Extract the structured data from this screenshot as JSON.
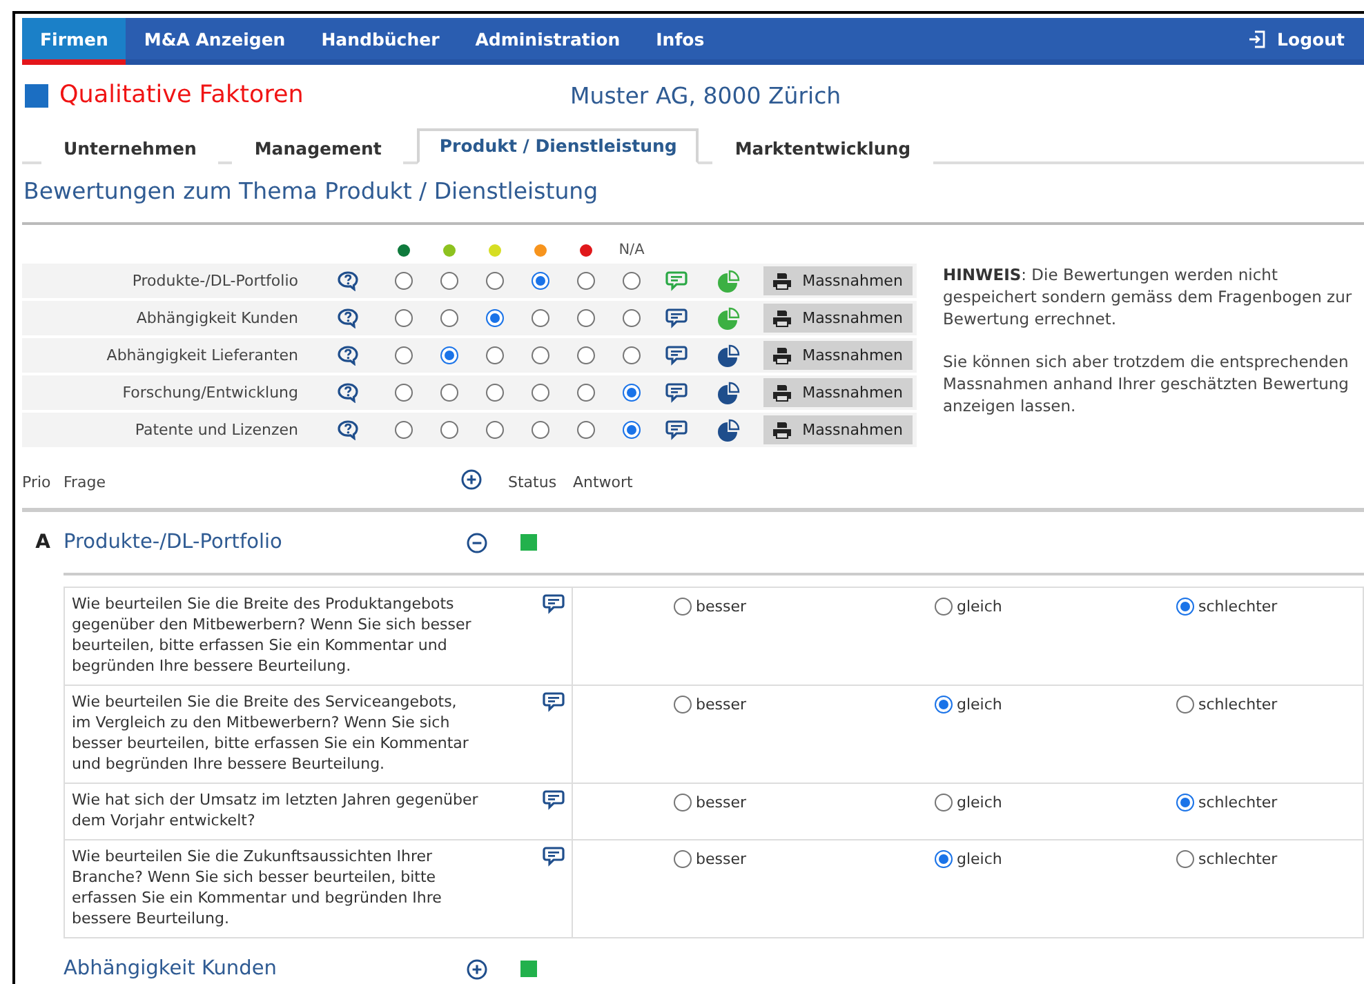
{
  "nav": {
    "items": [
      {
        "label": "Firmen",
        "selected": true
      },
      {
        "label": "M&A Anzeigen",
        "selected": false
      },
      {
        "label": "Handbücher",
        "selected": false
      },
      {
        "label": "Administration",
        "selected": false
      },
      {
        "label": "Infos",
        "selected": false
      }
    ],
    "logout": "Logout"
  },
  "header": {
    "title": "Qualitative Faktoren",
    "company": "Muster AG, 8000 Zürich"
  },
  "tabs": [
    {
      "label": "Unternehmen",
      "selected": false
    },
    {
      "label": "Management",
      "selected": false
    },
    {
      "label": "Produkt / Dienstleistung",
      "selected": true
    },
    {
      "label": "Marktentwicklung",
      "selected": false
    }
  ],
  "section_title": "Bewertungen zum Thema Produkt / Dienstleistung",
  "ratings": {
    "scale": [
      {
        "color": "#0f7a3c"
      },
      {
        "color": "#8dc21f"
      },
      {
        "color": "#d6de23"
      },
      {
        "color": "#f7941d"
      },
      {
        "color": "#e0181b"
      }
    ],
    "na_label": "N/A",
    "rows": [
      {
        "label": "Produkte-/DL-Portfolio",
        "options": [
          {
            "selected": false
          },
          {
            "selected": false
          },
          {
            "selected": false
          },
          {
            "selected": true
          },
          {
            "selected": false
          },
          {
            "selected": false
          }
        ],
        "comment": true,
        "color": "#3cb043",
        "button": "Massnahmen"
      },
      {
        "label": "Abhängigkeit Kunden",
        "options": [
          {
            "selected": false
          },
          {
            "selected": false
          },
          {
            "selected": true
          },
          {
            "selected": false
          },
          {
            "selected": false
          },
          {
            "selected": false
          }
        ],
        "comment": false,
        "color": "#3cb043",
        "button": "Massnahmen"
      },
      {
        "label": "Abhängigkeit Lieferanten",
        "options": [
          {
            "selected": false
          },
          {
            "selected": true
          },
          {
            "selected": false
          },
          {
            "selected": false
          },
          {
            "selected": false
          },
          {
            "selected": false
          }
        ],
        "comment": false,
        "color": "#1f4e8c",
        "button": "Massnahmen"
      },
      {
        "label": "Forschung/Entwicklung",
        "options": [
          {
            "selected": false
          },
          {
            "selected": false
          },
          {
            "selected": false
          },
          {
            "selected": false
          },
          {
            "selected": false
          },
          {
            "selected": true
          }
        ],
        "comment": false,
        "color": "#1f4e8c",
        "button": "Massnahmen"
      },
      {
        "label": "Patente und Lizenzen",
        "options": [
          {
            "selected": false
          },
          {
            "selected": false
          },
          {
            "selected": false
          },
          {
            "selected": false
          },
          {
            "selected": false
          },
          {
            "selected": true
          }
        ],
        "comment": false,
        "color": "#1f4e8c",
        "button": "Massnahmen"
      }
    ],
    "hint": [
      "**HINWEIS**: Die Bewertungen werden nicht gespeichert sondern gemäss dem Fragenbogen zur Bewertung errechnet.",
      "Sie können sich aber trotzdem die entsprechenden Massnahmen anhand Ihrer geschätzten Bewertung anzeigen lassen."
    ]
  },
  "list_header": {
    "prio": "Prio",
    "question": "Frage",
    "status": "Status",
    "answer": "Antwort"
  },
  "sections": [
    {
      "prio": "A",
      "title": "Produkte-/DL-Portfolio",
      "expanded": true,
      "color": "#22b14c",
      "questions": [
        {
          "text": "Wie beurteilen Sie die Breite des Produktangebots gegenüber den Mitbewerbern? Wenn Sie sich besser beurteilen, bitte erfassen Sie ein Kommentar und begründen Ihre bessere Beurteilung.",
          "options": [
            {
              "label": "besser",
              "selected": false
            },
            {
              "label": "gleich",
              "selected": false
            },
            {
              "label": "schlechter",
              "selected": true
            }
          ]
        },
        {
          "text": "Wie beurteilen Sie die Breite des Serviceangebots, im Vergleich zu den Mitbewerbern? Wenn Sie sich besser beurteilen, bitte erfassen Sie ein Kommentar und begründen Ihre bessere Beurteilung.",
          "options": [
            {
              "label": "besser",
              "selected": false
            },
            {
              "label": "gleich",
              "selected": true
            },
            {
              "label": "schlechter",
              "selected": false
            }
          ]
        },
        {
          "text": "Wie hat sich der Umsatz im letzten Jahren gegenüber dem Vorjahr entwickelt?",
          "options": [
            {
              "label": "besser",
              "selected": false
            },
            {
              "label": "gleich",
              "selected": false
            },
            {
              "label": "schlechter",
              "selected": true
            }
          ]
        },
        {
          "text": "Wie beurteilen Sie die Zukunftsaussichten Ihrer Branche? Wenn Sie sich besser beurteilen, bitte erfassen Sie ein Kommentar und begründen Ihre bessere Beurteilung.",
          "options": [
            {
              "label": "besser",
              "selected": false
            },
            {
              "label": "gleich",
              "selected": true
            },
            {
              "label": "schlechter",
              "selected": false
            }
          ]
        }
      ]
    },
    {
      "title": "Abhängigkeit Kunden",
      "expanded": false,
      "color": "#22b14c"
    }
  ]
}
